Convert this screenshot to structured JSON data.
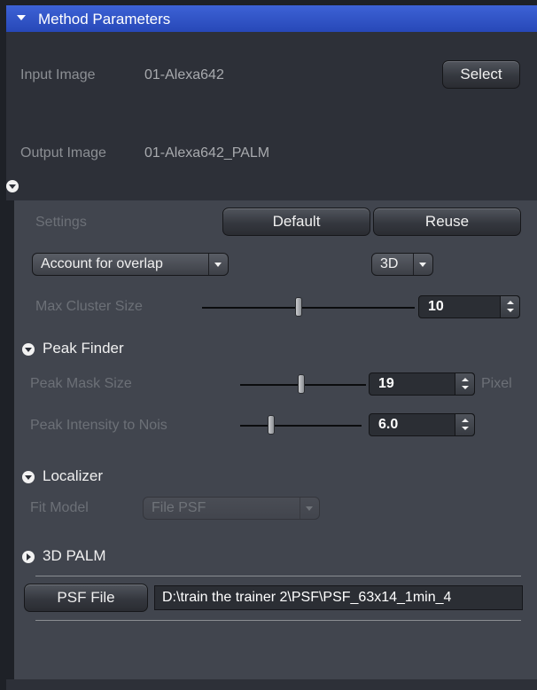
{
  "header": {
    "title": "Method Parameters"
  },
  "input_image": {
    "label": "Input Image",
    "value": "01-Alexa642",
    "select_label": "Select"
  },
  "output_image": {
    "label": "Output Image",
    "value": "01-Alexa642_PALM"
  },
  "settings": {
    "label": "Settings",
    "default_label": "Default",
    "reuse_label": "Reuse"
  },
  "options": {
    "overlap_mode": "Account for overlap",
    "dimension": "3D"
  },
  "max_cluster": {
    "label": "Max Cluster Size",
    "value": "10",
    "slider_fraction": 0.47
  },
  "peak_finder": {
    "title": "Peak Finder",
    "mask_label": "Peak Mask Size",
    "mask_value": "19",
    "mask_unit": "Pixel",
    "mask_slider_fraction": 0.55,
    "intensity_label": "Peak Intensity to Nois",
    "intensity_value": "6.0",
    "intensity_slider_fraction": 0.26
  },
  "localizer": {
    "title": "Localizer",
    "fit_model_label": "Fit Model",
    "fit_model_value": "File PSF"
  },
  "palm3d": {
    "title": "3D PALM",
    "psf_button_label": "PSF File",
    "psf_path": "D:\\train the trainer 2\\PSF\\PSF_63x14_1min_4"
  },
  "colors": {
    "header": "#2a4bbd",
    "panel": "#41454e",
    "background": "#2d3038"
  }
}
